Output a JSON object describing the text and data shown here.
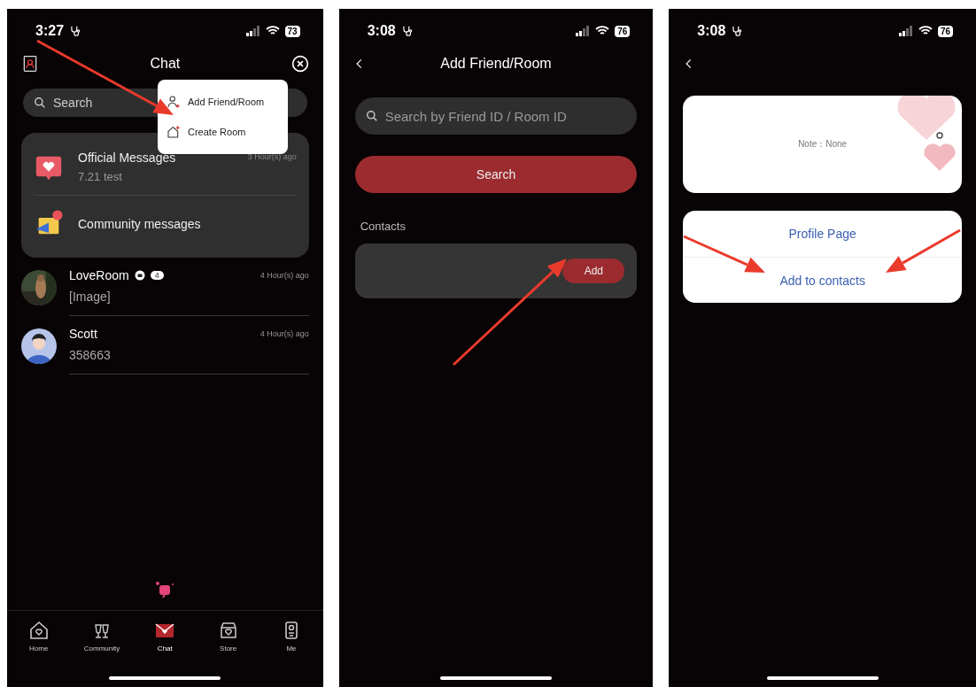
{
  "screens": [
    {
      "kind": "chat",
      "status": {
        "time": "3:27",
        "battery": "73"
      },
      "title": "Chat",
      "search": {
        "placeholder": "Search"
      },
      "menu": [
        {
          "label": "Add Friend/Room"
        },
        {
          "label": "Create Room"
        }
      ],
      "official": [
        {
          "title": "Official Messages",
          "subtitle": "7.21 test",
          "time": "3 Hour(s) ago"
        },
        {
          "title": "Community messages"
        }
      ],
      "conversations": [
        {
          "name": "LoveRoom",
          "preview": "[Image]",
          "time": "4 Hour(s) ago",
          "kind": "room",
          "members": "4"
        },
        {
          "name": "Scott",
          "preview": "358663",
          "time": "4 Hour(s) ago",
          "kind": "person"
        }
      ],
      "tabs": [
        {
          "label": "Home",
          "selected": false
        },
        {
          "label": "Community",
          "selected": false
        },
        {
          "label": "Chat",
          "selected": true
        },
        {
          "label": "Store",
          "selected": false
        },
        {
          "label": "Me",
          "selected": false
        }
      ]
    },
    {
      "kind": "add_friend",
      "status": {
        "time": "3:08",
        "battery": "76"
      },
      "title": "Add Friend/Room",
      "search": {
        "placeholder": "Search by Friend ID / Room ID"
      },
      "search_button": "Search",
      "section": "Contacts",
      "add_button": "Add"
    },
    {
      "kind": "contact",
      "status": {
        "time": "3:08",
        "battery": "76"
      },
      "note": "Note：None",
      "actions": [
        "Profile Page",
        "Add to contacts"
      ]
    }
  ]
}
